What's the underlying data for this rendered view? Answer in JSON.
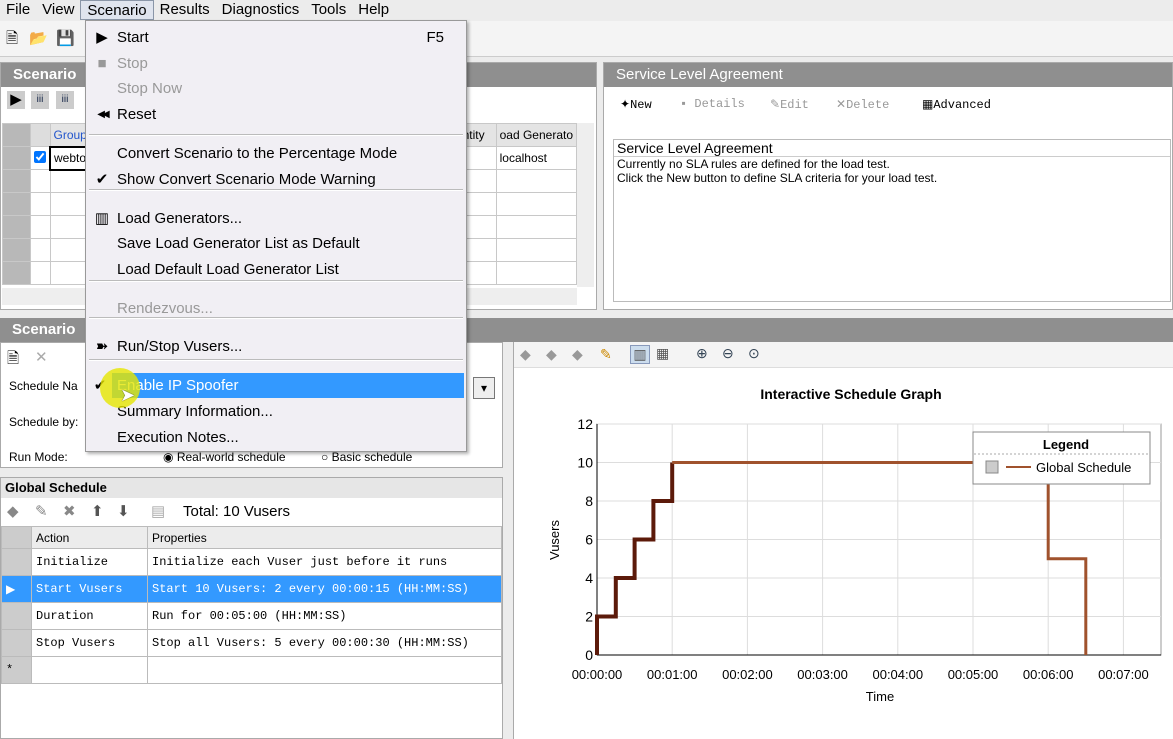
{
  "menubar": [
    "File",
    "View",
    "Scenario",
    "Results",
    "Diagnostics",
    "Tools",
    "Help"
  ],
  "scenario_panel": {
    "title": "Scenario",
    "columns": [
      "Group",
      "ntity",
      "oad Generato"
    ],
    "rows": [
      {
        "group": "webto",
        "load_generator": "localhost",
        "checked": true
      }
    ]
  },
  "sla": {
    "title": "Service Level Agreement",
    "toolbar": {
      "new": "New",
      "details": "Details",
      "edit": "Edit",
      "delete": "Delete",
      "advanced": "Advanced"
    },
    "box_title": "Service Level Agreement",
    "line1": "Currently no SLA rules are defined for the load test.",
    "line2": "Click the New button to define SLA criteria for your load test."
  },
  "schedule": {
    "title": "Scenario",
    "name_label": "Schedule Na",
    "by_label": "Schedule by:",
    "run_mode_label": "Run Mode:",
    "real_world": "Real-world schedule",
    "basic": "Basic schedule",
    "run_mode": "Real-world schedule"
  },
  "global": {
    "title": "Global Schedule",
    "total": "Total: 10 Vusers",
    "columns": [
      "Action",
      "Properties"
    ],
    "rows": [
      {
        "action": "Initialize",
        "props": "Initialize each Vuser just before it runs"
      },
      {
        "action": "Start  Vusers",
        "props": "Start 10 Vusers: 2 every 00:00:15 (HH:MM:SS)",
        "selected": true
      },
      {
        "action": "Duration",
        "props": "Run for 00:05:00 (HH:MM:SS)"
      },
      {
        "action": "Stop Vusers",
        "props": "Stop all Vusers: 5 every 00:00:30 (HH:MM:SS)"
      }
    ],
    "new_row": "*"
  },
  "menu": {
    "items": [
      {
        "label": "Start",
        "shortcut": "F5",
        "icon": "play-icon"
      },
      {
        "label": "Stop",
        "disabled": true,
        "icon": "stop-icon"
      },
      {
        "label": "Stop Now",
        "disabled": true
      },
      {
        "label": "Reset",
        "icon": "rewind-icon"
      },
      {
        "label": "Convert Scenario to the Percentage Mode"
      },
      {
        "label": "Show Convert Scenario Mode Warning",
        "checked": true
      },
      {
        "label": "Load Generators...",
        "icon": "load-generators-icon"
      },
      {
        "label": "Save Load Generator List as Default"
      },
      {
        "label": "Load Default Load Generator List"
      },
      {
        "label": "Rendezvous...",
        "disabled": true
      },
      {
        "label": "Run/Stop Vusers...",
        "icon": "run-stop-icon"
      },
      {
        "label": "Enable IP Spoofer",
        "checked": true,
        "highlighted": true
      },
      {
        "label": "Summary Information..."
      },
      {
        "label": "Execution Notes..."
      }
    ]
  },
  "chart_data": {
    "type": "line",
    "title": "Interactive Schedule Graph",
    "xlabel": "Time",
    "ylabel": "Vusers",
    "xticks": [
      "00:00:00",
      "00:01:00",
      "00:02:00",
      "00:03:00",
      "00:04:00",
      "00:05:00",
      "00:06:00",
      "00:07:00"
    ],
    "yticks": [
      0,
      2,
      4,
      6,
      8,
      10,
      12
    ],
    "xlim_seconds": [
      0,
      450
    ],
    "ylim": [
      0,
      12
    ],
    "grid": true,
    "legend": "top-right",
    "legend_title": "Legend",
    "series": [
      {
        "name": "Global Schedule",
        "color": "#a0522d",
        "ramp_color": "#5c1a0a",
        "points": [
          [
            "00:00:00",
            0
          ],
          [
            "00:00:00",
            2
          ],
          [
            "00:00:15",
            2
          ],
          [
            "00:00:15",
            4
          ],
          [
            "00:00:30",
            4
          ],
          [
            "00:00:30",
            6
          ],
          [
            "00:00:45",
            6
          ],
          [
            "00:00:45",
            8
          ],
          [
            "00:01:00",
            8
          ],
          [
            "00:01:00",
            10
          ],
          [
            "00:06:00",
            10
          ],
          [
            "00:06:00",
            5
          ],
          [
            "00:06:30",
            5
          ],
          [
            "00:06:30",
            0
          ]
        ]
      }
    ]
  }
}
